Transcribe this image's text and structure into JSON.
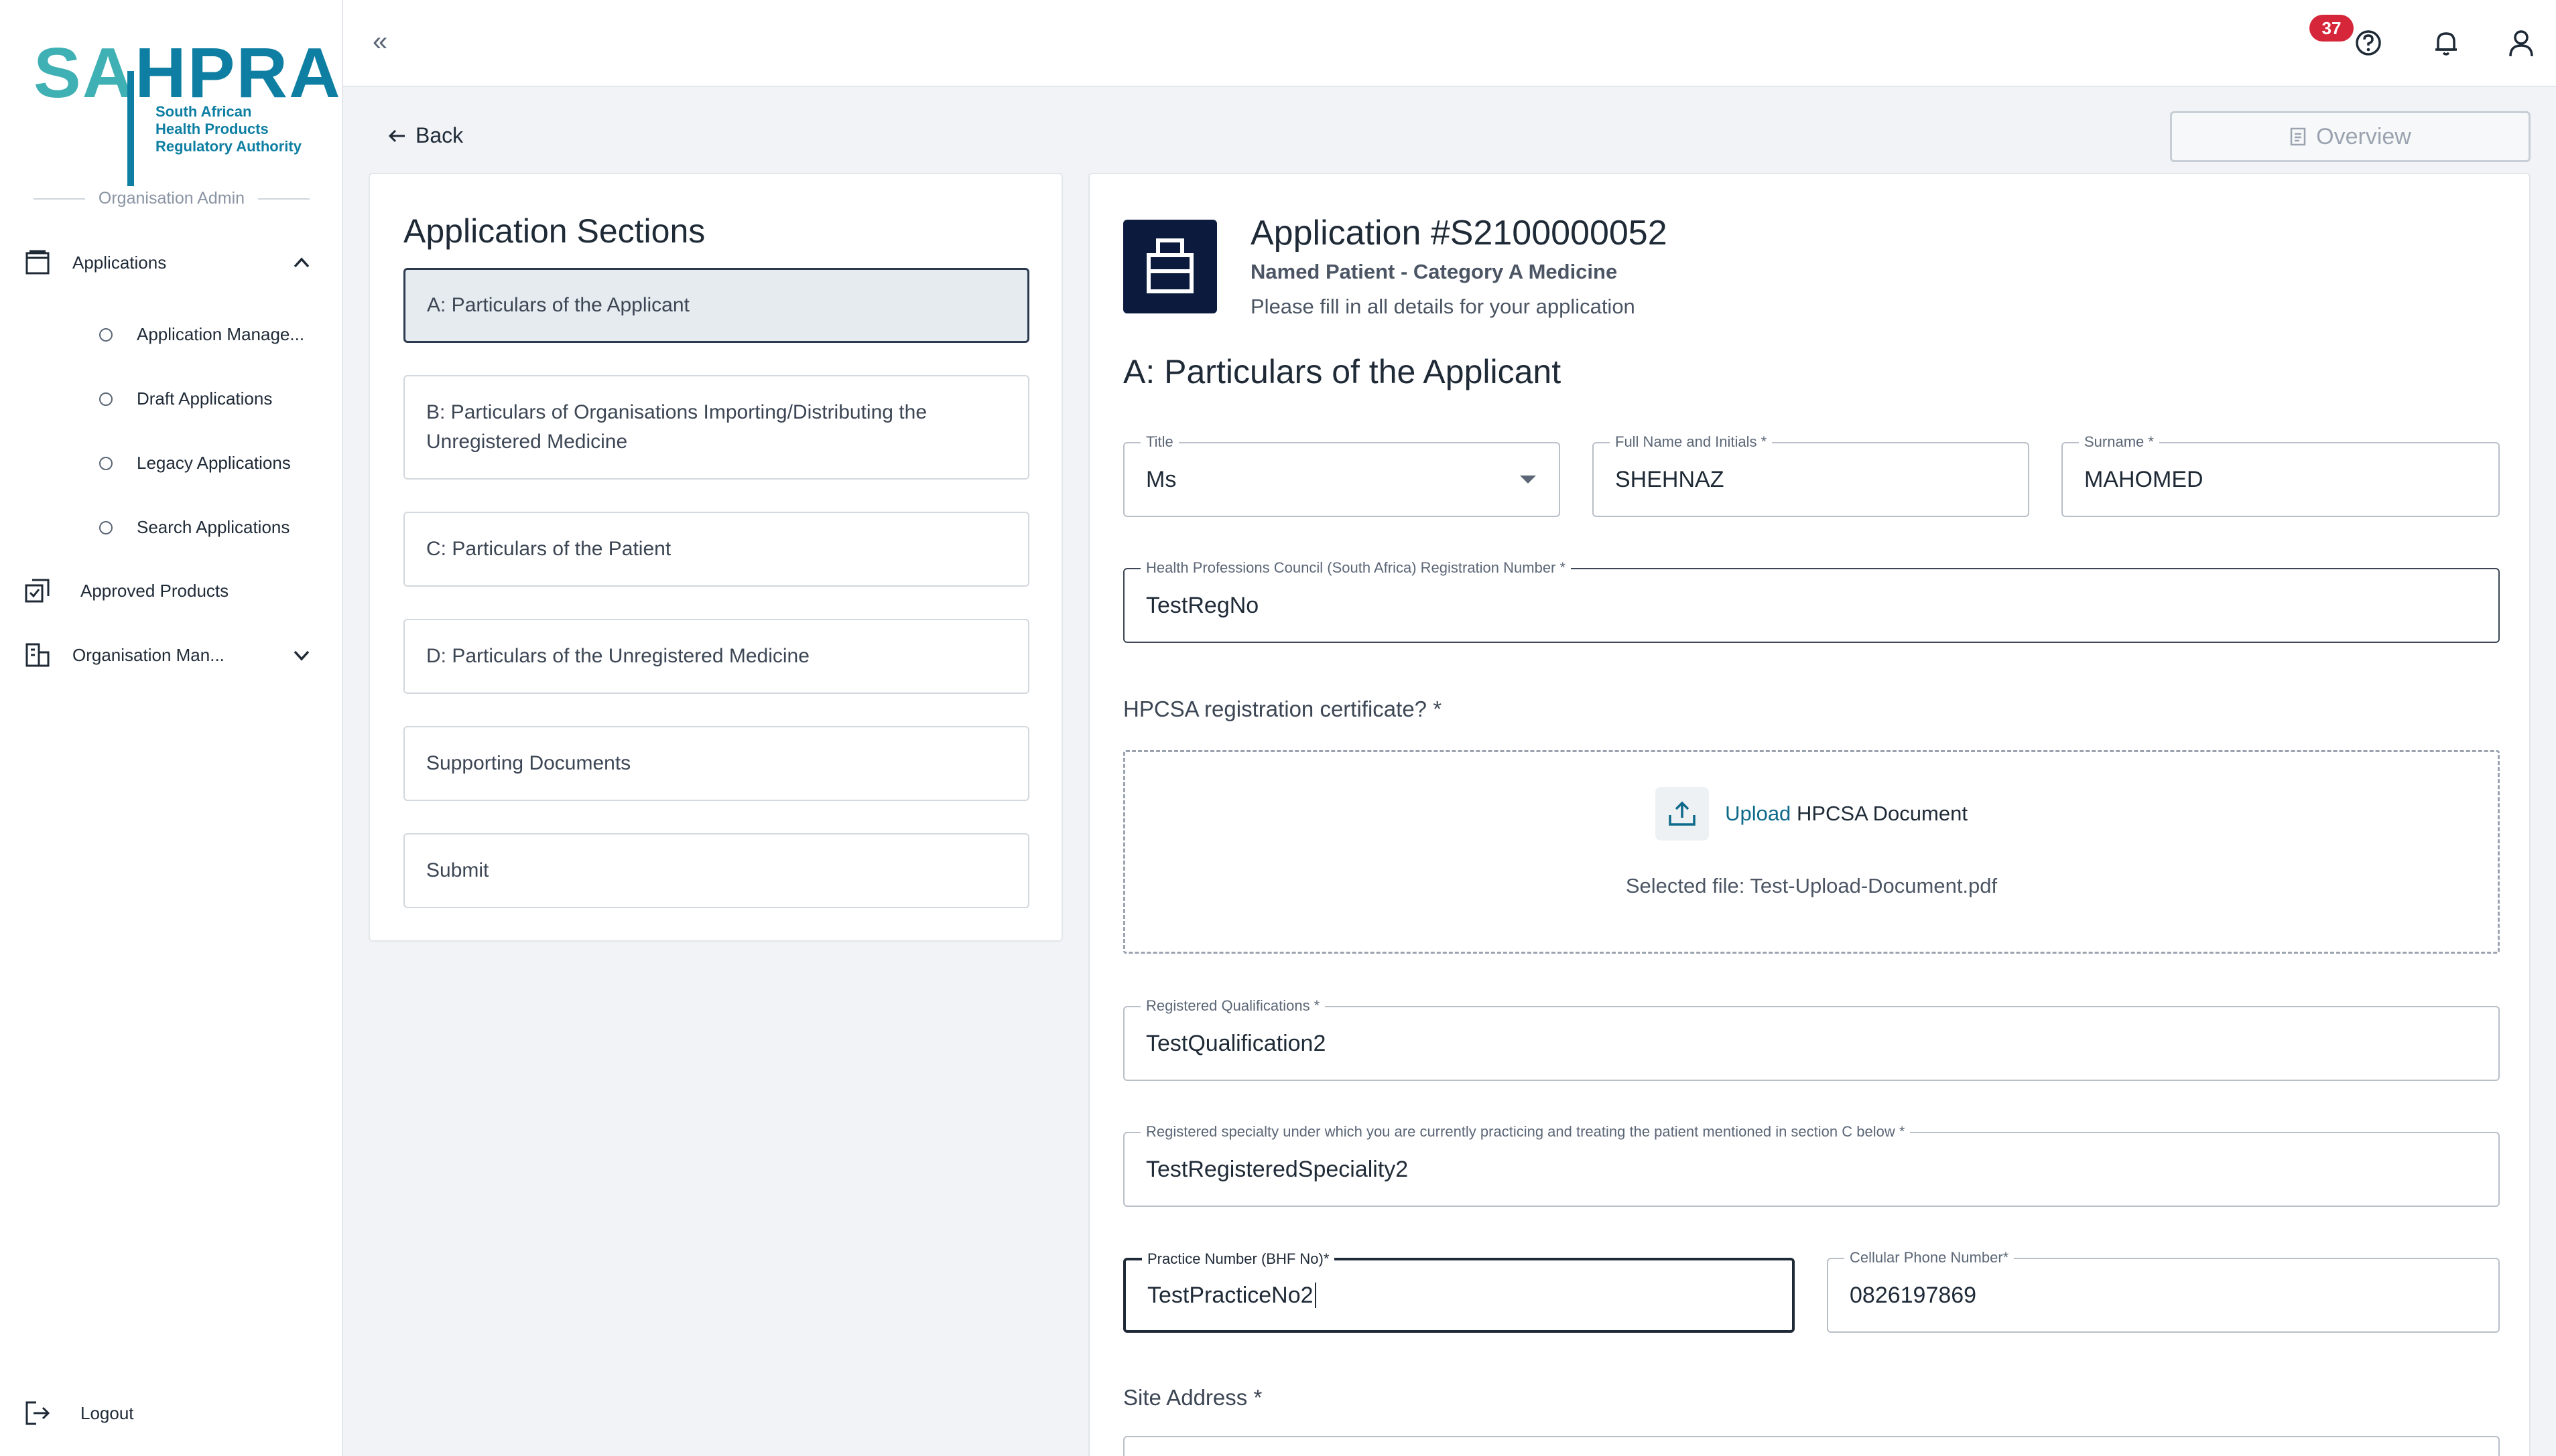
{
  "logo": {
    "letters_sa": "SA",
    "letters_hpra": "HPRA",
    "line1": "South African",
    "line2": "Health Products",
    "line3": "Regulatory Authority"
  },
  "sidebar": {
    "section_label": "Organisation Admin",
    "applications_label": "Applications",
    "sub_items": [
      "Application Manage...",
      "Draft Applications",
      "Legacy Applications",
      "Search Applications"
    ],
    "approved_products": "Approved Products",
    "organisation_man": "Organisation Man...",
    "logout": "Logout"
  },
  "topbar": {
    "collapse_glyph": "«",
    "notification_count": "37"
  },
  "nav": {
    "back": "Back",
    "overview": "Overview"
  },
  "sections": {
    "title": "Application Sections",
    "items": [
      "A: Particulars of the Applicant",
      "B: Particulars of Organisations Importing/Distributing the Unregistered Medicine",
      "C: Particulars of the Patient",
      "D: Particulars of the Unregistered Medicine",
      "Supporting Documents",
      "Submit"
    ]
  },
  "application": {
    "title": "Application #S2100000052",
    "subtitle": "Named Patient - Category A Medicine",
    "hint": "Please fill in all details for your application",
    "section_heading": "A: Particulars of the Applicant",
    "fields": {
      "title": {
        "label": "Title",
        "value": "Ms"
      },
      "full_name": {
        "label": "Full Name and Initials *",
        "value": "SHEHNAZ"
      },
      "surname": {
        "label": "Surname *",
        "value": "MAHOMED"
      },
      "hpcsa_reg": {
        "label": "Health Professions Council (South Africa) Registration Number *",
        "value": "TestRegNo"
      },
      "qualifications": {
        "label": "Registered Qualifications *",
        "value": "TestQualification2"
      },
      "specialty": {
        "label": "Registered specialty under which you are currently practicing and treating the patient mentioned in section C below *",
        "value": "TestRegisteredSpeciality2"
      },
      "practice_number": {
        "label": "Practice Number (BHF No)*",
        "value": "TestPracticeNo2"
      },
      "cellular": {
        "label": "Cellular Phone Number*",
        "value": "0826197869"
      }
    },
    "certificate_question": "HPCSA registration certificate? *",
    "upload_link": "Upload",
    "upload_text": "HPCSA Document",
    "selected_file": "Selected file: Test-Upload-Document.pdf",
    "site_address_label": "Site Address *"
  },
  "colors": {
    "brand_teal": "#3fb0b3",
    "brand_blue": "#0e7fa2",
    "badge_red": "#d6273a",
    "app_icon_bg": "#0b1a3d"
  },
  "icons": [
    "help-icon",
    "bell-icon",
    "user-icon",
    "applications-icon",
    "approved-products-icon",
    "organisation-icon",
    "logout-icon",
    "upload-icon",
    "document-icon",
    "back-arrow-icon"
  ]
}
